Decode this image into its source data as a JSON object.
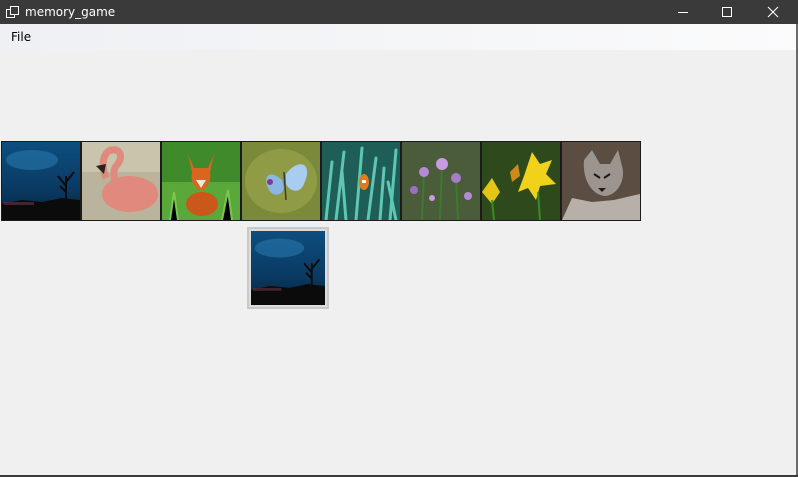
{
  "window": {
    "title": "memory_game",
    "controls": [
      "minimize-icon",
      "maximize-icon",
      "close-icon"
    ]
  },
  "menu": {
    "items": [
      {
        "label": "File"
      }
    ]
  },
  "board": {
    "cards": [
      {
        "subject": "stormy night sky with bare tree",
        "icon": "night-tree-image"
      },
      {
        "subject": "flamingo",
        "icon": "flamingo-image"
      },
      {
        "subject": "red fox in grass",
        "icon": "fox-image"
      },
      {
        "subject": "blue butterfly",
        "icon": "butterfly-image"
      },
      {
        "subject": "sea anemone with clownfish",
        "icon": "anemone-image"
      },
      {
        "subject": "purple wildflowers",
        "icon": "wildflowers-image"
      },
      {
        "subject": "butterfly on yellow flowers",
        "icon": "yellow-flowers-image"
      },
      {
        "subject": "wolf",
        "icon": "wolf-image"
      }
    ],
    "selected_card": {
      "subject": "stormy night sky with bare tree",
      "icon": "night-tree-image"
    }
  }
}
